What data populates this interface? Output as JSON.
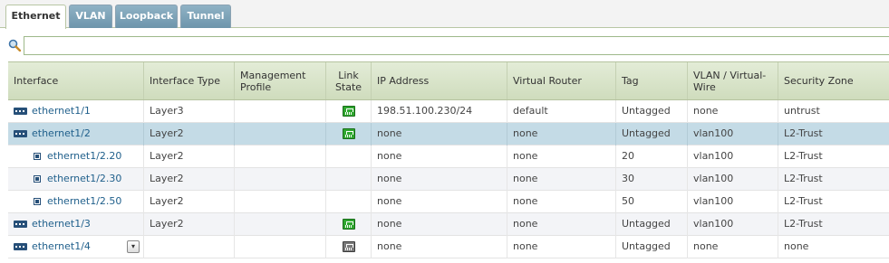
{
  "tabs": [
    {
      "label": "Ethernet",
      "active": true
    },
    {
      "label": "VLAN",
      "active": false
    },
    {
      "label": "Loopback",
      "active": false
    },
    {
      "label": "Tunnel",
      "active": false
    }
  ],
  "filter": {
    "value": "",
    "placeholder": ""
  },
  "columns": [
    "Interface",
    "Interface Type",
    "Management Profile",
    "Link State",
    "IP Address",
    "Virtual Router",
    "Tag",
    "VLAN / Virtual-Wire",
    "Security Zone"
  ],
  "link_state_colors": {
    "up": "#2fa72f",
    "down": "#7a7a7a"
  },
  "rows": [
    {
      "interface": "ethernet1/1",
      "sub": false,
      "type": "Layer3",
      "profile": "",
      "link": "up",
      "ip": "198.51.100.230/24",
      "router": "default",
      "tag": "Untagged",
      "vlan": "none",
      "zone": "untrust"
    },
    {
      "interface": "ethernet1/2",
      "sub": false,
      "type": "Layer2",
      "profile": "",
      "link": "up",
      "ip": "none",
      "router": "none",
      "tag": "Untagged",
      "vlan": "vlan100",
      "zone": "L2-Trust"
    },
    {
      "interface": "ethernet1/2.20",
      "sub": true,
      "type": "Layer2",
      "profile": "",
      "link": "",
      "ip": "none",
      "router": "none",
      "tag": "20",
      "vlan": "vlan100",
      "zone": "L2-Trust"
    },
    {
      "interface": "ethernet1/2.30",
      "sub": true,
      "type": "Layer2",
      "profile": "",
      "link": "",
      "ip": "none",
      "router": "none",
      "tag": "30",
      "vlan": "vlan100",
      "zone": "L2-Trust"
    },
    {
      "interface": "ethernet1/2.50",
      "sub": true,
      "type": "Layer2",
      "profile": "",
      "link": "",
      "ip": "none",
      "router": "none",
      "tag": "50",
      "vlan": "vlan100",
      "zone": "L2-Trust"
    },
    {
      "interface": "ethernet1/3",
      "sub": false,
      "type": "Layer2",
      "profile": "",
      "link": "up",
      "ip": "none",
      "router": "none",
      "tag": "Untagged",
      "vlan": "vlan100",
      "zone": "L2-Trust"
    },
    {
      "interface": "ethernet1/4",
      "sub": false,
      "type": "",
      "profile": "",
      "link": "down",
      "ip": "none",
      "router": "none",
      "tag": "Untagged",
      "vlan": "none",
      "zone": "none"
    }
  ]
}
